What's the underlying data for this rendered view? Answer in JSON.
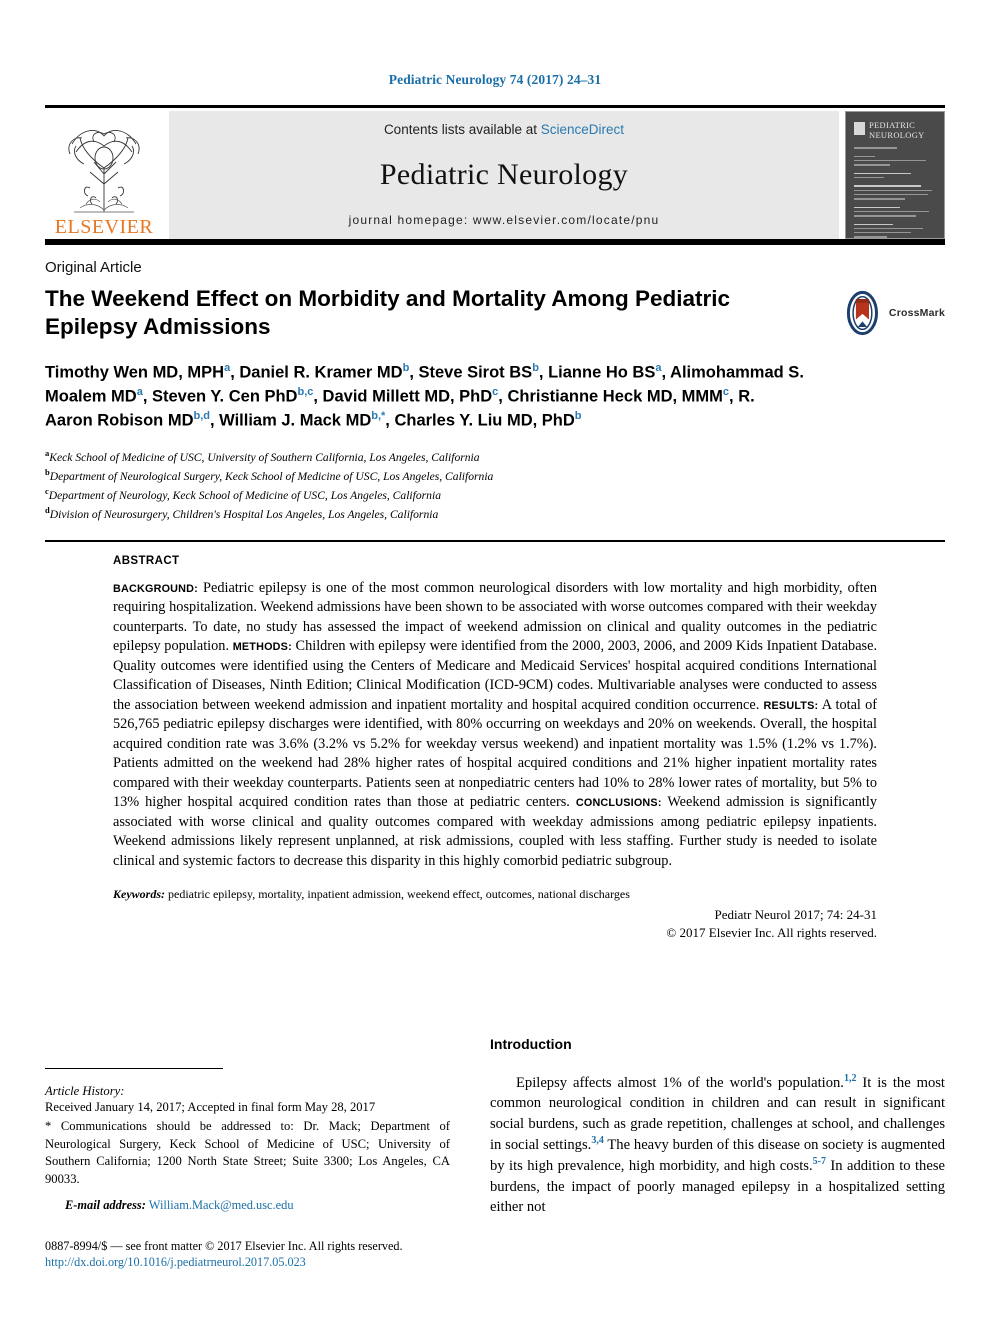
{
  "running_head": "Pediatric Neurology 74 (2017) 24–31",
  "masthead": {
    "contents_prefix": "Contents lists available at ",
    "sciencedirect": "ScienceDirect",
    "journal_title": "Pediatric Neurology",
    "homepage": "journal homepage: www.elsevier.com/locate/pnu",
    "publisher": "ELSEVIER",
    "cover_title": "PEDIATRIC NEUROLOGY"
  },
  "article": {
    "type_label": "Original Article",
    "title": "The Weekend Effect on Morbidity and Mortality Among Pediatric Epilepsy Admissions",
    "crossmark_label": "CrossMark",
    "authors_html": "Timothy Wen MD, MPH<sup>a</sup>, Daniel R. Kramer MD<sup>b</sup>, Steve Sirot BS<sup>b</sup>, Lianne Ho BS<sup>a</sup>, Alimohammad S. Moalem MD<sup>a</sup>, Steven Y. Cen PhD<sup>b,c</sup>, David Millett MD, PhD<sup>c</sup>, Christianne Heck MD, MMM<sup>c</sup>, R. Aaron Robison MD<sup>b,d</sup>, William J. Mack MD<sup>b,*</sup>, Charles Y. Liu MD, PhD<sup>b</sup>",
    "affiliations": [
      {
        "mark": "a",
        "text": "Keck School of Medicine of USC, University of Southern California, Los Angeles, California"
      },
      {
        "mark": "b",
        "text": "Department of Neurological Surgery, Keck School of Medicine of USC, Los Angeles, California"
      },
      {
        "mark": "c",
        "text": "Department of Neurology, Keck School of Medicine of USC, Los Angeles, California"
      },
      {
        "mark": "d",
        "text": "Division of Neurosurgery, Children's Hospital Los Angeles, Los Angeles, California"
      }
    ]
  },
  "abstract": {
    "label": "ABSTRACT",
    "sections": [
      {
        "heading": "BACKGROUND:",
        "text": "Pediatric epilepsy is one of the most common neurological disorders with low mortality and high morbidity, often requiring hospitalization. Weekend admissions have been shown to be associated with worse outcomes compared with their weekday counterparts. To date, no study has assessed the impact of weekend admission on clinical and quality outcomes in the pediatric epilepsy population."
      },
      {
        "heading": "METHODS:",
        "text": "Children with epilepsy were identified from the 2000, 2003, 2006, and 2009 Kids Inpatient Database. Quality outcomes were identified using the Centers of Medicare and Medicaid Services' hospital acquired conditions International Classification of Diseases, Ninth Edition; Clinical Modification (ICD-9CM) codes. Multivariable analyses were conducted to assess the association between weekend admission and inpatient mortality and hospital acquired condition occurrence."
      },
      {
        "heading": "RESULTS:",
        "text": "A total of 526,765 pediatric epilepsy discharges were identified, with 80% occurring on weekdays and 20% on weekends. Overall, the hospital acquired condition rate was 3.6% (3.2% vs 5.2% for weekday versus weekend) and inpatient mortality was 1.5% (1.2% vs 1.7%). Patients admitted on the weekend had 28% higher rates of hospital acquired conditions and 21% higher inpatient mortality rates compared with their weekday counterparts. Patients seen at nonpediatric centers had 10% to 28% lower rates of mortality, but 5% to 13% higher hospital acquired condition rates than those at pediatric centers."
      },
      {
        "heading": "CONCLUSIONS:",
        "text": "Weekend admission is significantly associated with worse clinical and quality outcomes compared with weekday admissions among pediatric epilepsy inpatients. Weekend admissions likely represent unplanned, at risk admissions, coupled with less staffing. Further study is needed to isolate clinical and systemic factors to decrease this disparity in this highly comorbid pediatric subgroup."
      }
    ],
    "keywords_label": "Keywords:",
    "keywords": "pediatric epilepsy, mortality, inpatient admission, weekend effect, outcomes, national discharges",
    "citation": "Pediatr Neurol 2017; 74: 24-31",
    "copyright": "© 2017 Elsevier Inc. All rights reserved."
  },
  "footer": {
    "history_label": "Article History:",
    "history": "Received January 14, 2017; Accepted in final form May 28, 2017",
    "correspondence": "* Communications should be addressed to: Dr. Mack; Department of Neurological Surgery, Keck School of Medicine of USC; University of Southern California; 1200 North State Street; Suite 3300; Los Angeles, CA 90033.",
    "email_label": "E-mail address:",
    "email": "William.Mack@med.usc.edu",
    "issn_line": "0887-8994/$ — see front matter © 2017 Elsevier Inc. All rights reserved.",
    "doi": "http://dx.doi.org/10.1016/j.pediatrneurol.2017.05.023"
  },
  "introduction": {
    "heading": "Introduction",
    "paragraph_html": "Epilepsy affects almost 1% of the world's population.<sup>1,2</sup> It is the most common neurological condition in children and can result in significant social burdens, such as grade repetition, challenges at school, and challenges in social settings.<sup>3,4</sup> The heavy burden of this disease on society is augmented by its high prevalence, high morbidity, and high costs.<sup>5-7</sup> In addition to these burdens, the impact of poorly managed epilepsy in a hospitalized setting either not"
  },
  "colors": {
    "link_blue": "#1b6fa8",
    "elsevier_orange": "#e87722",
    "banner_grey": "#e8e8e8",
    "cover_grey": "#4a4a4a"
  }
}
